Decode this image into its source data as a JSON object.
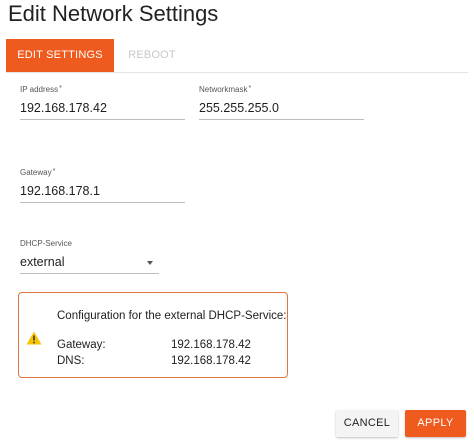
{
  "page": {
    "title": "Edit Network Settings"
  },
  "tabs": [
    {
      "label": "EDIT SETTINGS",
      "active": true
    },
    {
      "label": "REBOOT",
      "active": false
    }
  ],
  "form": {
    "ip": {
      "label": "IP address",
      "required_mark": "*",
      "value": "192.168.178.42"
    },
    "mask": {
      "label": "Networkmask",
      "required_mark": "*",
      "value": "255.255.255.0"
    },
    "gateway": {
      "label": "Gateway",
      "required_mark": "*",
      "value": "192.168.178.1"
    },
    "dhcp": {
      "label": "DHCP-Service",
      "value": "external"
    }
  },
  "alert": {
    "icon": "warning-icon",
    "heading": "Configuration for the external DHCP-Service:",
    "rows": [
      {
        "key": "Gateway:",
        "value": "192.168.178.42"
      },
      {
        "key": "DNS:",
        "value": "192.168.178.42"
      }
    ]
  },
  "actions": {
    "cancel": "CANCEL",
    "apply": "APPLY"
  },
  "colors": {
    "accent": "#ef5a1f",
    "alert_border": "#e0763e",
    "warning": "#f7c400"
  }
}
